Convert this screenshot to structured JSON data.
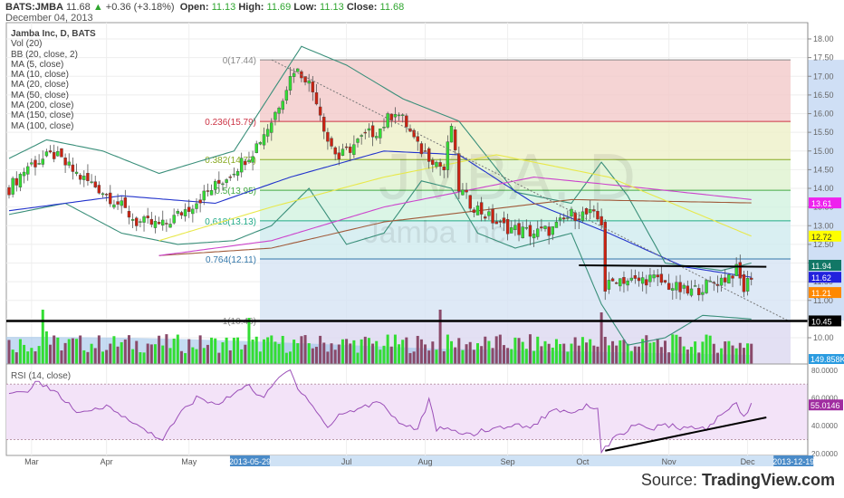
{
  "header": {
    "symbol": "BATS:JMBA",
    "last": "11.68",
    "change": "+0.36 (+3.18%)",
    "open_label": "Open:",
    "open": "11.13",
    "high_label": "High:",
    "high": "11.69",
    "low_label": "Low:",
    "low": "11.13",
    "close_label": "Close:",
    "close": "11.68",
    "date": "December 04, 2013"
  },
  "legend": [
    "Jamba Inc, D, BATS",
    "Vol (20)",
    "BB (20, close, 2)",
    "MA (5, close)",
    "MA (10, close)",
    "MA (20, close)",
    "MA (50, close)",
    "MA (200, close)",
    "MA (150, close)",
    "MA (100, close)"
  ],
  "watermark": {
    "symbol": "JMBA, D",
    "name": "Jamba Inc"
  },
  "source": {
    "prefix": "Source: ",
    "site": "TradingView.com"
  },
  "colors": {
    "up": "#33dd33",
    "down": "#cc2211",
    "bb": "#3a8f7a",
    "ma50": "#2233cc",
    "ma200": "#a05a3a",
    "ma150": "#cc44cc",
    "ma100": "#e8e84a",
    "rsi": "#9b4fb8"
  },
  "chart_data": {
    "type": "candlestick",
    "bars": 199,
    "price_axis": {
      "min": 9.6,
      "max": 18.2,
      "ticks": [
        "18.00",
        "17.50",
        "17.00",
        "16.50",
        "16.00",
        "15.50",
        "15.00",
        "14.50",
        "14.00",
        "13.50",
        "13.00",
        "12.50",
        "12.00",
        "11.50",
        "11.00",
        "10.50",
        "10.00"
      ]
    },
    "time_labels": [
      {
        "label": "Mar",
        "bar": 6
      },
      {
        "label": "Apr",
        "bar": 26
      },
      {
        "label": "May",
        "bar": 48
      },
      {
        "label": "Jul",
        "bar": 90
      },
      {
        "label": "Aug",
        "bar": 111
      },
      {
        "label": "Sep",
        "bar": 133
      },
      {
        "label": "Oct",
        "bar": 153
      },
      {
        "label": "Nov",
        "bar": 176
      },
      {
        "label": "Dec",
        "bar": 197
      }
    ],
    "time_highlights": [
      {
        "label": "2013-05-29",
        "bar": 64
      },
      {
        "label": "2013-12-19",
        "bar": 209
      }
    ],
    "close_keypoints": [
      [
        0,
        14.0
      ],
      [
        5,
        14.6
      ],
      [
        12,
        14.9
      ],
      [
        19,
        14.3
      ],
      [
        24,
        14.0
      ],
      [
        29,
        13.6
      ],
      [
        34,
        13.1
      ],
      [
        41,
        13.0
      ],
      [
        48,
        13.5
      ],
      [
        53,
        13.9
      ],
      [
        58,
        14.3
      ],
      [
        65,
        15.0
      ],
      [
        70,
        15.8
      ],
      [
        76,
        17.2
      ],
      [
        79,
        17.0
      ],
      [
        82,
        16.4
      ],
      [
        85,
        15.3
      ],
      [
        88,
        14.8
      ],
      [
        90,
        15.0
      ],
      [
        95,
        15.4
      ],
      [
        99,
        15.6
      ],
      [
        103,
        16.1
      ],
      [
        106,
        15.7
      ],
      [
        109,
        15.1
      ],
      [
        113,
        14.8
      ],
      [
        116,
        14.5
      ],
      [
        118,
        15.7
      ],
      [
        120,
        14.0
      ],
      [
        123,
        13.6
      ],
      [
        127,
        13.3
      ],
      [
        131,
        13.0
      ],
      [
        135,
        12.9
      ],
      [
        140,
        12.8
      ],
      [
        145,
        12.9
      ],
      [
        150,
        13.3
      ],
      [
        155,
        13.3
      ],
      [
        158,
        13.1
      ],
      [
        159,
        11.3
      ],
      [
        162,
        11.6
      ],
      [
        167,
        11.5
      ],
      [
        171,
        11.6
      ],
      [
        176,
        11.4
      ],
      [
        181,
        11.2
      ],
      [
        186,
        11.4
      ],
      [
        191,
        11.6
      ],
      [
        194,
        11.8
      ],
      [
        196,
        11.3
      ],
      [
        198,
        11.68
      ]
    ],
    "indicators": [
      {
        "name": "BB upper",
        "color": "#3a8f7a",
        "points": [
          [
            0,
            14.8
          ],
          [
            10,
            15.3
          ],
          [
            25,
            15.0
          ],
          [
            40,
            14.4
          ],
          [
            60,
            15.0
          ],
          [
            78,
            17.8
          ],
          [
            90,
            17.3
          ],
          [
            105,
            16.4
          ],
          [
            120,
            15.8
          ],
          [
            135,
            13.9
          ],
          [
            150,
            13.6
          ],
          [
            158,
            14.7
          ],
          [
            165,
            13.8
          ],
          [
            175,
            12.0
          ],
          [
            190,
            11.8
          ],
          [
            198,
            12.0
          ]
        ]
      },
      {
        "name": "BB lower",
        "color": "#3a8f7a",
        "points": [
          [
            0,
            13.3
          ],
          [
            15,
            13.6
          ],
          [
            30,
            12.8
          ],
          [
            45,
            12.5
          ],
          [
            60,
            12.6
          ],
          [
            70,
            13.0
          ],
          [
            80,
            14.0
          ],
          [
            90,
            12.5
          ],
          [
            100,
            12.8
          ],
          [
            110,
            14.2
          ],
          [
            118,
            14.0
          ],
          [
            125,
            12.8
          ],
          [
            135,
            12.4
          ],
          [
            150,
            12.8
          ],
          [
            158,
            10.9
          ],
          [
            165,
            9.8
          ],
          [
            175,
            10.0
          ],
          [
            185,
            10.6
          ],
          [
            198,
            10.5
          ]
        ]
      },
      {
        "name": "MA 50",
        "color": "#2233cc",
        "points": [
          [
            0,
            13.4
          ],
          [
            30,
            13.8
          ],
          [
            55,
            13.6
          ],
          [
            75,
            14.3
          ],
          [
            100,
            15.0
          ],
          [
            120,
            14.9
          ],
          [
            140,
            13.6
          ],
          [
            160,
            12.8
          ],
          [
            180,
            11.9
          ],
          [
            198,
            11.62
          ]
        ]
      },
      {
        "name": "MA 200",
        "color": "#a05a3a",
        "points": [
          [
            40,
            12.2
          ],
          [
            70,
            12.4
          ],
          [
            100,
            13.1
          ],
          [
            150,
            13.7
          ],
          [
            198,
            13.61
          ]
        ]
      },
      {
        "name": "MA 150",
        "color": "#cc44cc",
        "points": [
          [
            40,
            12.2
          ],
          [
            70,
            12.6
          ],
          [
            100,
            13.5
          ],
          [
            140,
            14.3
          ],
          [
            170,
            14.0
          ],
          [
            198,
            13.7
          ]
        ]
      },
      {
        "name": "MA 100",
        "color": "#e8e84a",
        "points": [
          [
            40,
            12.6
          ],
          [
            70,
            13.5
          ],
          [
            100,
            14.3
          ],
          [
            130,
            14.9
          ],
          [
            160,
            14.3
          ],
          [
            198,
            12.72
          ]
        ]
      }
    ],
    "fib": [
      {
        "label": "0(17.44)",
        "v": 17.44,
        "color": "#888888"
      },
      {
        "label": "0.236(15.79)",
        "v": 15.79,
        "color": "#cc3344"
      },
      {
        "label": "0.382(14.77)",
        "v": 14.77,
        "color": "#88aa22"
      },
      {
        "label": "0.5(13.95)",
        "v": 13.95,
        "color": "#44aa44"
      },
      {
        "label": "0.618(13.13)",
        "v": 13.13,
        "color": "#22aa88"
      },
      {
        "label": "0.764(12.11)",
        "v": 12.11,
        "color": "#3377aa"
      },
      {
        "label": "1(10.46)",
        "v": 10.46,
        "color": "#888888"
      }
    ],
    "price_badges": [
      {
        "label": "13.61",
        "color": "#ee22ee",
        "v": 13.61
      },
      {
        "label": "12.72",
        "color": "#ffff00",
        "v": 12.72,
        "dark": true
      },
      {
        "label": "11.94",
        "color": "#117766",
        "v": 11.94
      },
      {
        "label": "11.62",
        "color": "#2222dd",
        "v": 11.62
      },
      {
        "label": "11.21",
        "color": "#ff8800",
        "v": 11.21
      },
      {
        "label": "10.45",
        "color": "#000000",
        "v": 10.45
      }
    ],
    "support_line": 10.45,
    "resistance_line": {
      "from": [
        152,
        11.94
      ],
      "to": [
        202,
        11.9
      ]
    },
    "volume": {
      "last_label": "149.858K",
      "spikes": [
        [
          9,
          1.0
        ],
        [
          10,
          0.6
        ],
        [
          64,
          0.85
        ],
        [
          65,
          0.45
        ],
        [
          115,
          1.0
        ],
        [
          158,
          0.95
        ],
        [
          159,
          0.5
        ]
      ]
    },
    "rsi": {
      "label": "RSI (14, close)",
      "last_label": "55.0146",
      "ticks": [
        "80.0000",
        "60.0000",
        "40.0000",
        "20.0000"
      ],
      "bands": [
        30,
        70
      ],
      "points": [
        [
          0,
          62
        ],
        [
          4,
          64
        ],
        [
          8,
          72
        ],
        [
          12,
          65
        ],
        [
          19,
          48
        ],
        [
          27,
          55
        ],
        [
          31,
          45
        ],
        [
          41,
          30
        ],
        [
          46,
          50
        ],
        [
          50,
          60
        ],
        [
          56,
          55
        ],
        [
          63,
          70
        ],
        [
          68,
          60
        ],
        [
          72,
          75
        ],
        [
          75,
          80
        ],
        [
          77,
          68
        ],
        [
          81,
          55
        ],
        [
          85,
          38
        ],
        [
          88,
          48
        ],
        [
          93,
          52
        ],
        [
          99,
          58
        ],
        [
          104,
          42
        ],
        [
          109,
          38
        ],
        [
          112,
          58
        ],
        [
          114,
          38
        ],
        [
          123,
          34
        ],
        [
          133,
          40
        ],
        [
          140,
          40
        ],
        [
          145,
          52
        ],
        [
          150,
          50
        ],
        [
          155,
          55
        ],
        [
          157,
          52
        ],
        [
          158,
          22
        ],
        [
          162,
          32
        ],
        [
          167,
          40
        ],
        [
          171,
          38
        ],
        [
          176,
          40
        ],
        [
          181,
          38
        ],
        [
          186,
          38
        ],
        [
          191,
          50
        ],
        [
          194,
          56
        ],
        [
          196,
          47
        ],
        [
          198,
          55
        ]
      ],
      "trendline": {
        "from": [
          159,
          22
        ],
        "to": [
          202,
          46
        ]
      }
    }
  }
}
